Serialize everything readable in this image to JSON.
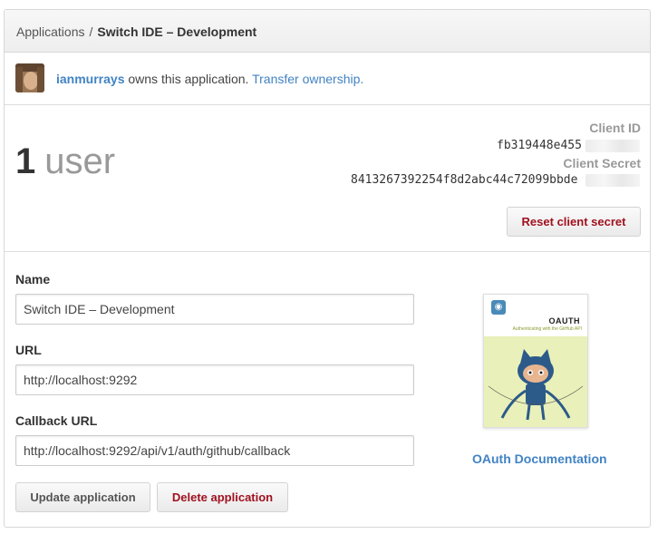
{
  "breadcrumb": {
    "parent": "Applications",
    "separator": "/",
    "current": "Switch IDE – Development"
  },
  "owner": {
    "username": "ianmurrays",
    "text": "owns this application.",
    "transfer_link": "Transfer ownership."
  },
  "stats": {
    "user_count": "1",
    "user_label": "user"
  },
  "credentials": {
    "client_id_label": "Client ID",
    "client_id": "fb319448e455",
    "client_secret_label": "Client Secret",
    "client_secret": "8413267392254f8d2abc44c72099bbde",
    "reset_button": "Reset client secret"
  },
  "form": {
    "name_label": "Name",
    "name_value": "Switch IDE – Development",
    "url_label": "URL",
    "url_value": "http://localhost:9292",
    "callback_label": "Callback URL",
    "callback_value": "http://localhost:9292/api/v1/auth/github/callback",
    "update_button": "Update application",
    "delete_button": "Delete application"
  },
  "docs": {
    "book_title": "OAUTH",
    "book_subtitle": "Authenticating with the GitHub API",
    "link_label": "OAuth Documentation"
  },
  "colors": {
    "link": "#4183c4",
    "danger": "#a0111f",
    "muted": "#999999"
  }
}
